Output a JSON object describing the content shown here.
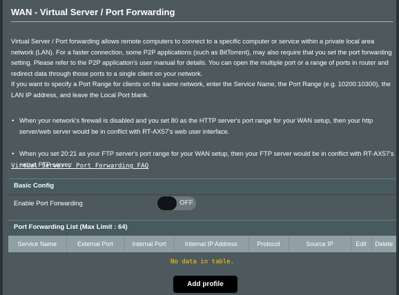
{
  "page": {
    "title": "WAN - Virtual Server / Port Forwarding",
    "description_1": "Virtual Server / Port forwarding allows remote computers to connect to a specific computer or service within a private local area network (LAN). For a faster connection, some P2P applications (such as BitTorrent), may also require that you set the port forwarding setting. Please refer to the P2P application's user manual for details. You can open the multiple port or a range of ports in router and redirect data through those ports to a single client on your network.",
    "description_2": "If you want to specify a Port Range for clients on the same network, enter the Service Name, the Port Range (e.g. 10200:10300), the LAN IP address, and leave the Local Port blank.",
    "notes": [
      "When your network's firewall is disabled and you set 80 as the HTTP server's port range for your WAN setup, then your http server/web server would be in conflict with RT-AX57's web user interface.",
      "When you set 20:21 as your FTP server's port range for your WAN setup, then your FTP server would be in conflict with RT-AX57's native FTP server."
    ],
    "faq_link": "Virtual Server / Port Forwarding FAQ"
  },
  "basic_config": {
    "header": "Basic Config",
    "enable_label": "Enable Port Forwarding",
    "toggle_state": "OFF"
  },
  "port_forwarding_list": {
    "header": "Port Forwarding List (Max Limit : 64)",
    "columns": [
      "Service Name",
      "External Port",
      "Internal Port",
      "Internal IP Address",
      "Protocol",
      "Source IP",
      "Edit",
      "Delete"
    ],
    "empty_message": "No data in table."
  },
  "actions": {
    "add_profile": "Add profile"
  },
  "colors": {
    "background": "#4d595d",
    "table_header": "#90a0a5",
    "empty_text": "#ffcc00",
    "button": "#000000"
  }
}
